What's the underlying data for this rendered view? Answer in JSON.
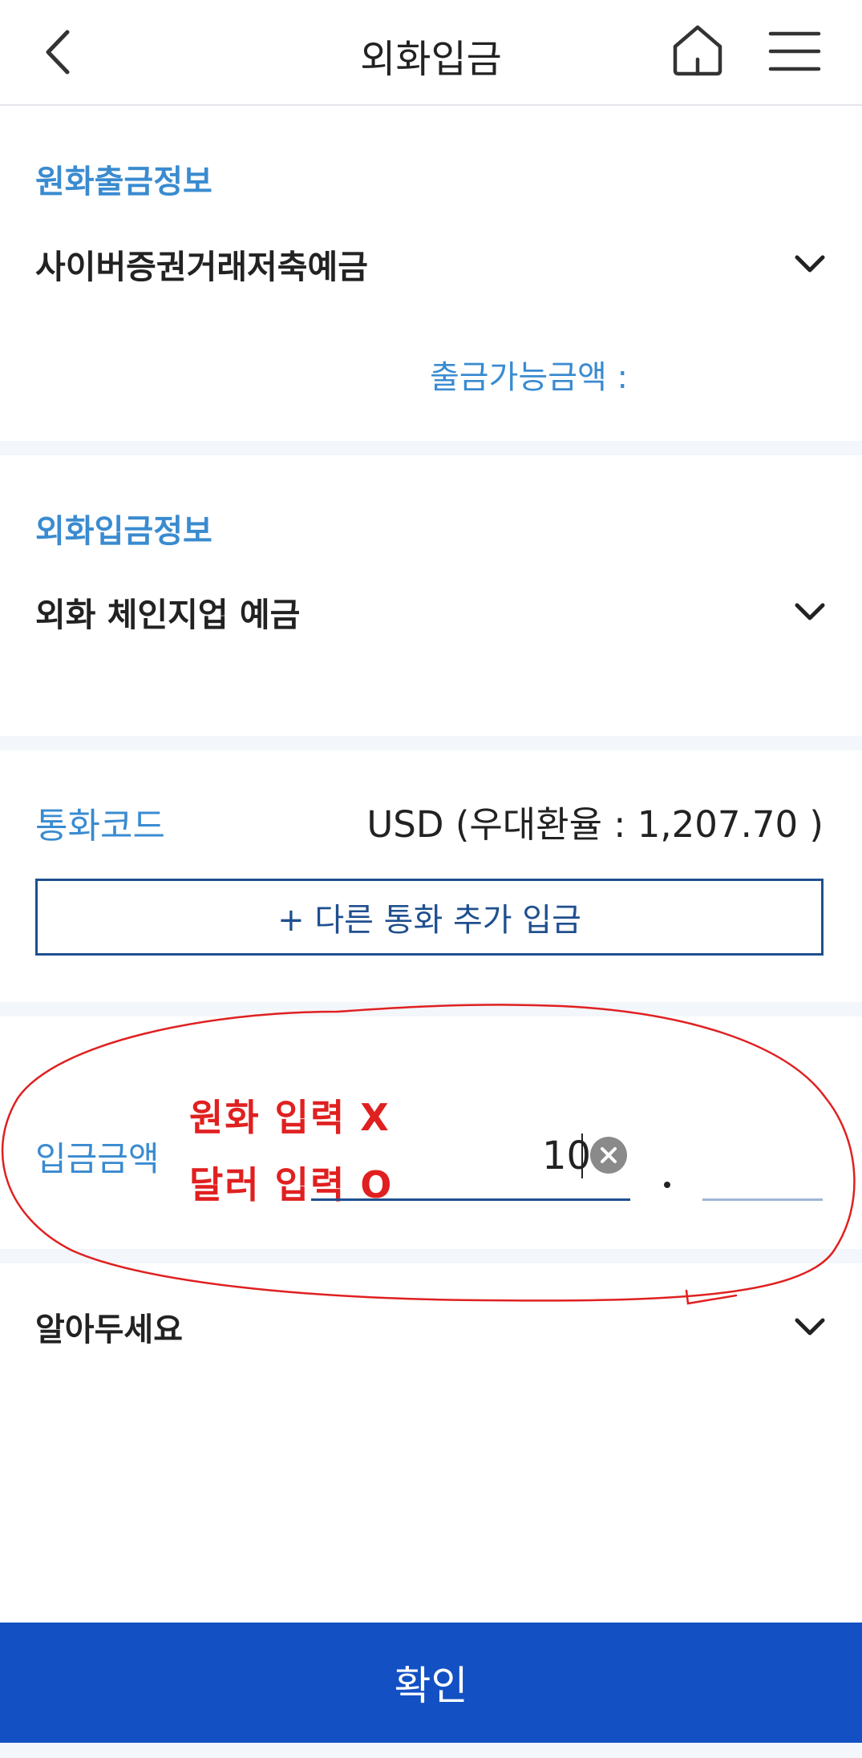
{
  "header": {
    "title": "외화입금",
    "back_icon": "chevron-left-icon",
    "home_icon": "home-icon",
    "menu_icon": "hamburger-menu-icon"
  },
  "withdrawal": {
    "section_title": "원화출금정보",
    "account_name": "사이버증권거래저축예금",
    "available_label": "출금가능금액 :",
    "available_value": ""
  },
  "deposit": {
    "section_title": "외화입금정보",
    "account_name": "외화 체인지업 예금"
  },
  "currency": {
    "label": "통화코드",
    "value": "USD (우대환율 : 1,207.70 )",
    "add_button_label": "+ 다른 통화 추가 입금"
  },
  "amount": {
    "label": "입금금액",
    "integer_value": "10",
    "decimal_value": "",
    "note_line1": "원화 입력 X",
    "note_line2": "달러 입력 O"
  },
  "notice": {
    "label": "알아두세요"
  },
  "confirm_button": {
    "label": "확인"
  },
  "colors": {
    "accent_blue": "#3a8bd0",
    "primary_button": "#1350c4",
    "annotation_red": "#e02020",
    "section_gap": "#f3f6fa"
  }
}
